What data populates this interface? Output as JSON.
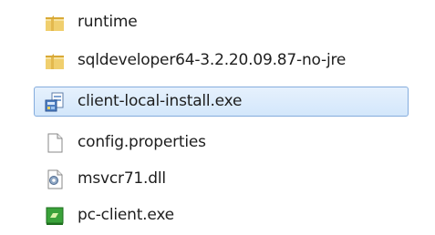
{
  "files": [
    {
      "name": "runtime",
      "icon": "folder-icon",
      "selected": false
    },
    {
      "name": "sqldeveloper64-3.2.20.09.87-no-jre",
      "icon": "folder-icon",
      "selected": false
    },
    {
      "name": "client-local-install.exe",
      "icon": "installer-icon",
      "selected": true
    },
    {
      "name": "config.properties",
      "icon": "blank-document-icon",
      "selected": false
    },
    {
      "name": "msvcr71.dll",
      "icon": "dll-gear-icon",
      "selected": false
    },
    {
      "name": "pc-client.exe",
      "icon": "green-app-icon",
      "selected": false
    }
  ],
  "colors": {
    "selection_fill": "#d9eafb",
    "selection_border": "#84acdd",
    "folder": "#e8c45c",
    "app_green": "#3aa23a"
  }
}
